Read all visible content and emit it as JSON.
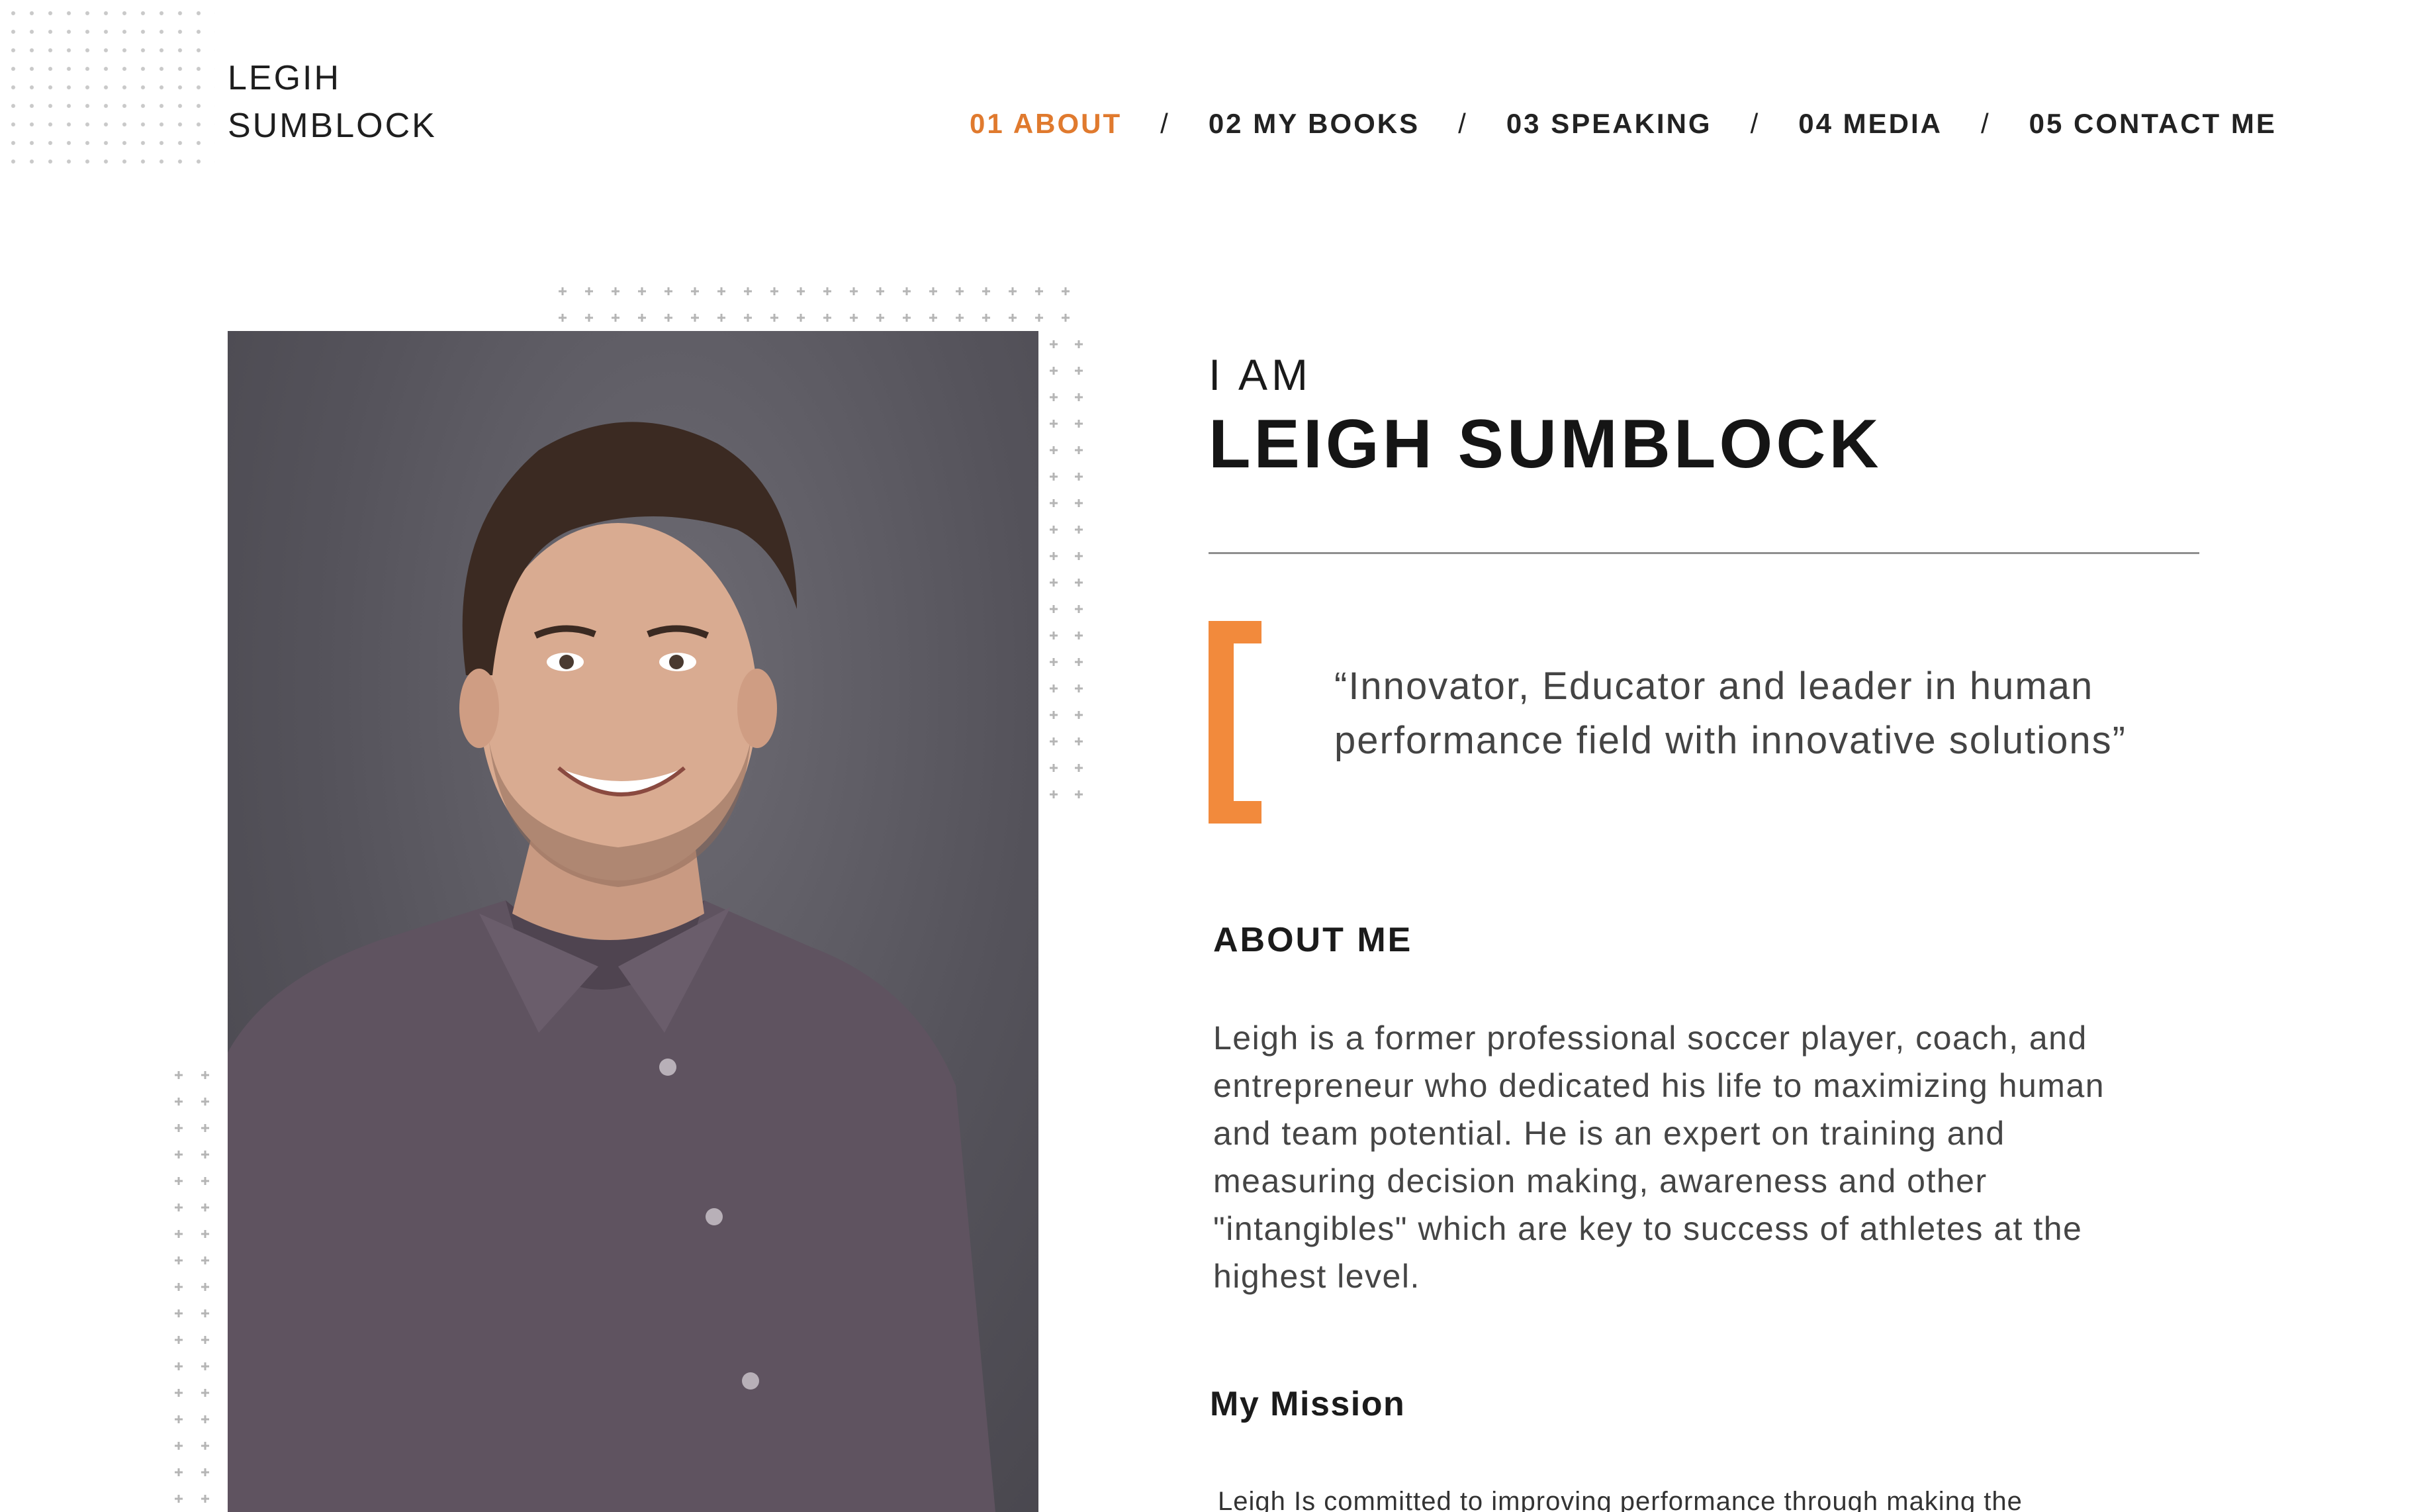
{
  "logo": {
    "line1": "LEGIH",
    "line2": "SUMBLOCK"
  },
  "nav": {
    "items": [
      {
        "label": "01 ABOUT",
        "active": true
      },
      {
        "label": "02 MY BOOKS",
        "active": false
      },
      {
        "label": "03 SPEAKING",
        "active": false
      },
      {
        "label": "04 MEDIA",
        "active": false
      },
      {
        "label": "05 CONTACT ME",
        "active": false
      }
    ],
    "separator": "/"
  },
  "hero": {
    "intro": "I AM",
    "name": "LEIGH SUMBLOCK",
    "quote": "“Innovator, Educator and leader in human performance field with innovative solutions”"
  },
  "about": {
    "title": "ABOUT ME",
    "body": "Leigh is a former professional soccer player, coach, and\nentrepreneur who dedicated his life to maximizing human\nand team potential.  He is an expert on training and\nmeasuring decision making, awareness and other\n\"intangibles\" which are key to success of athletes at the\nhighest level."
  },
  "mission": {
    "title": "My Mission",
    "body": "Leigh Is committed to improving performance through making the"
  },
  "colors": {
    "accent": "#e07a2e",
    "bracket": "#f28a3c",
    "text": "#1c1c1c",
    "body_text": "#454545",
    "divider": "#8f8f8f"
  }
}
